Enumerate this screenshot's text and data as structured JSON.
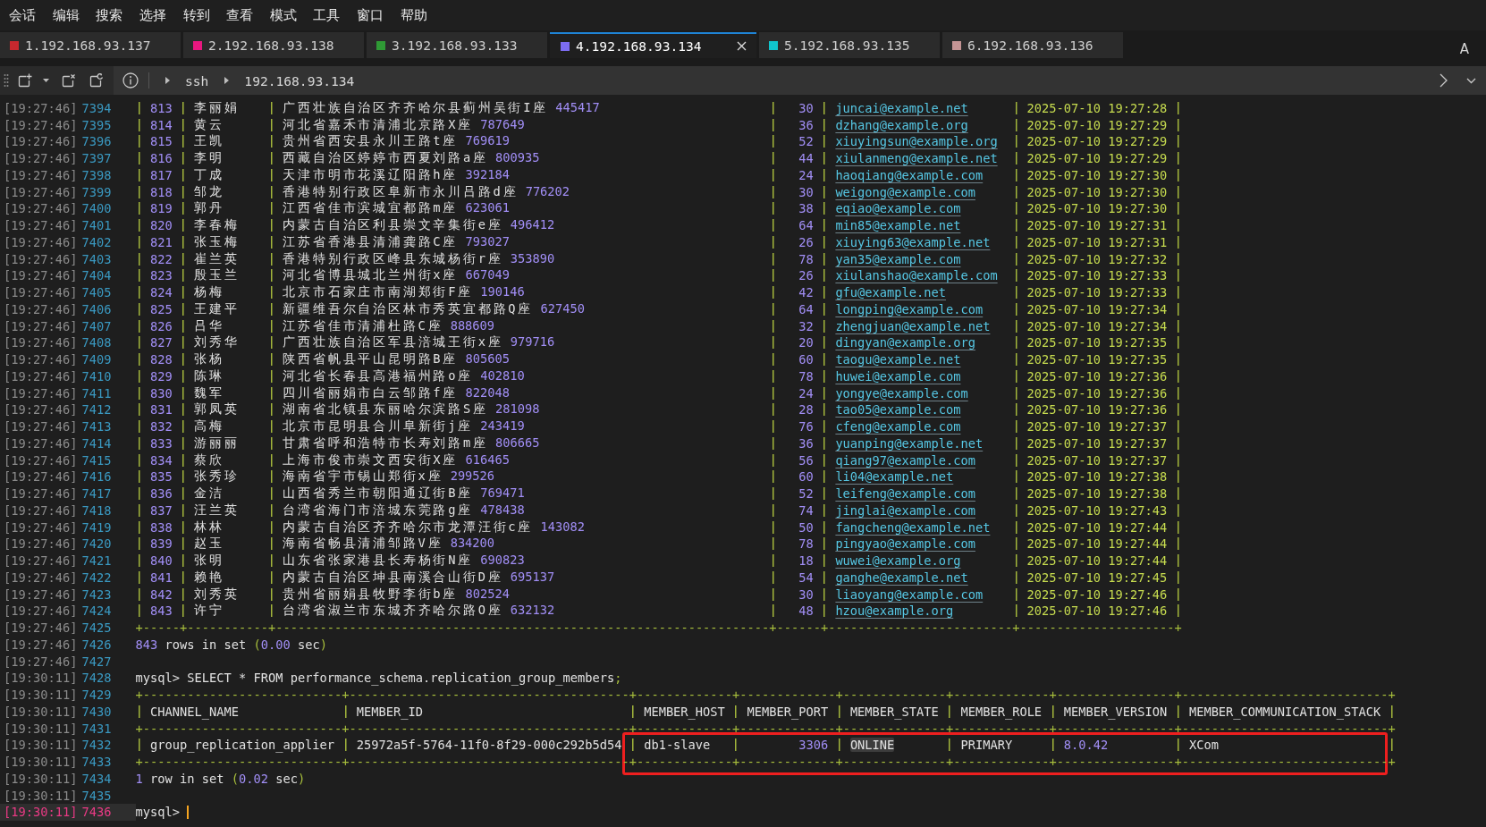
{
  "menu": [
    "会话",
    "编辑",
    "搜索",
    "选择",
    "转到",
    "查看",
    "模式",
    "工具",
    "窗口",
    "帮助"
  ],
  "tabs": [
    {
      "label": "1.192.168.93.137",
      "color": "#c8282e",
      "selected": false
    },
    {
      "label": "2.192.168.93.138",
      "color": "#e8177f",
      "selected": false
    },
    {
      "label": "3.192.168.93.133",
      "color": "#2f9a35",
      "selected": false
    },
    {
      "label": "4.192.168.93.134",
      "color": "#7c6cf0",
      "selected": true
    },
    {
      "label": "5.192.168.93.135",
      "color": "#10c4cc",
      "selected": false
    },
    {
      "label": "6.192.168.93.136",
      "color": "#c49494",
      "selected": false
    }
  ],
  "tab_bar_button": "A",
  "toolbar": {
    "breadcrumb": [
      "ssh",
      "192.168.93.134"
    ]
  },
  "terminal": {
    "lines": [
      {
        "time": "[19:27:46]",
        "number": "7394",
        "current": false,
        "kind": "record",
        "id": "813",
        "name": "李丽娟",
        "address": "广西壮族自治区齐齐哈尔县蓟州吴街I座",
        "postcode": "445417",
        "age": "30",
        "email": "juncai@example.net",
        "date": "2025-07-10 19:27:28"
      },
      {
        "time": "[19:27:46]",
        "number": "7395",
        "current": false,
        "kind": "record",
        "id": "814",
        "name": "黄云",
        "address": "河北省嘉禾市清浦北京路X座",
        "postcode": "787649",
        "age": "36",
        "email": "dzhang@example.org",
        "date": "2025-07-10 19:27:29"
      },
      {
        "time": "[19:27:46]",
        "number": "7396",
        "current": false,
        "kind": "record",
        "id": "815",
        "name": "王凯",
        "address": "贵州省西安县永川王路t座",
        "postcode": "769619",
        "age": "52",
        "email": "xiuyingsun@example.org",
        "date": "2025-07-10 19:27:29"
      },
      {
        "time": "[19:27:46]",
        "number": "7397",
        "current": false,
        "kind": "record",
        "id": "816",
        "name": "李明",
        "address": "西藏自治区婷婷市西夏刘路a座",
        "postcode": "800935",
        "age": "44",
        "email": "xiulanmeng@example.net",
        "date": "2025-07-10 19:27:29"
      },
      {
        "time": "[19:27:46]",
        "number": "7398",
        "current": false,
        "kind": "record",
        "id": "817",
        "name": "丁成",
        "address": "天津市明市花溪辽阳路h座",
        "postcode": "392184",
        "age": "24",
        "email": "haoqiang@example.com",
        "date": "2025-07-10 19:27:30"
      },
      {
        "time": "[19:27:46]",
        "number": "7399",
        "current": false,
        "kind": "record",
        "id": "818",
        "name": "邹龙",
        "address": "香港特别行政区阜新市永川吕路d座",
        "postcode": "776202",
        "age": "30",
        "email": "weigong@example.com",
        "date": "2025-07-10 19:27:30"
      },
      {
        "time": "[19:27:46]",
        "number": "7400",
        "current": false,
        "kind": "record",
        "id": "819",
        "name": "郭丹",
        "address": "江西省佳市滨城宜都路m座",
        "postcode": "623061",
        "age": "38",
        "email": "eqiao@example.com",
        "date": "2025-07-10 19:27:30"
      },
      {
        "time": "[19:27:46]",
        "number": "7401",
        "current": false,
        "kind": "record",
        "id": "820",
        "name": "李春梅",
        "address": "内蒙古自治区利县崇文辛集街e座",
        "postcode": "496412",
        "age": "64",
        "email": "min85@example.net",
        "date": "2025-07-10 19:27:31"
      },
      {
        "time": "[19:27:46]",
        "number": "7402",
        "current": false,
        "kind": "record",
        "id": "821",
        "name": "张玉梅",
        "address": "江苏省香港县清浦龚路C座",
        "postcode": "793027",
        "age": "26",
        "email": "xiuying63@example.net",
        "date": "2025-07-10 19:27:31"
      },
      {
        "time": "[19:27:46]",
        "number": "7403",
        "current": false,
        "kind": "record",
        "id": "822",
        "name": "崔兰英",
        "address": "香港特别行政区峰县东城杨街r座",
        "postcode": "353890",
        "age": "78",
        "email": "yan35@example.com",
        "date": "2025-07-10 19:27:32"
      },
      {
        "time": "[19:27:46]",
        "number": "7404",
        "current": false,
        "kind": "record",
        "id": "823",
        "name": "殷玉兰",
        "address": "河北省博县城北兰州街x座",
        "postcode": "667049",
        "age": "26",
        "email": "xiulanshao@example.com",
        "date": "2025-07-10 19:27:33"
      },
      {
        "time": "[19:27:46]",
        "number": "7405",
        "current": false,
        "kind": "record",
        "id": "824",
        "name": "杨梅",
        "address": "北京市石家庄市南湖郑街F座",
        "postcode": "190146",
        "age": "42",
        "email": "gfu@example.net",
        "date": "2025-07-10 19:27:33"
      },
      {
        "time": "[19:27:46]",
        "number": "7406",
        "current": false,
        "kind": "record",
        "id": "825",
        "name": "王建平",
        "address": "新疆维吾尔自治区林市秀英宜都路Q座",
        "postcode": "627450",
        "age": "64",
        "email": "longping@example.com",
        "date": "2025-07-10 19:27:34"
      },
      {
        "time": "[19:27:46]",
        "number": "7407",
        "current": false,
        "kind": "record",
        "id": "826",
        "name": "吕华",
        "address": "江苏省佳市清浦杜路C座",
        "postcode": "888609",
        "age": "32",
        "email": "zhengjuan@example.net",
        "date": "2025-07-10 19:27:34"
      },
      {
        "time": "[19:27:46]",
        "number": "7408",
        "current": false,
        "kind": "record",
        "id": "827",
        "name": "刘秀华",
        "address": "广西壮族自治区军县涪城王街x座",
        "postcode": "979716",
        "age": "20",
        "email": "dingyan@example.org",
        "date": "2025-07-10 19:27:35"
      },
      {
        "time": "[19:27:46]",
        "number": "7409",
        "current": false,
        "kind": "record",
        "id": "828",
        "name": "张杨",
        "address": "陕西省帆县平山昆明路B座",
        "postcode": "805605",
        "age": "60",
        "email": "taogu@example.net",
        "date": "2025-07-10 19:27:35"
      },
      {
        "time": "[19:27:46]",
        "number": "7410",
        "current": false,
        "kind": "record",
        "id": "829",
        "name": "陈琳",
        "address": "河北省长春县高港福州路o座",
        "postcode": "402810",
        "age": "78",
        "email": "huwei@example.com",
        "date": "2025-07-10 19:27:36"
      },
      {
        "time": "[19:27:46]",
        "number": "7411",
        "current": false,
        "kind": "record",
        "id": "830",
        "name": "魏军",
        "address": "四川省丽娟市白云邹路f座",
        "postcode": "822048",
        "age": "24",
        "email": "yongye@example.com",
        "date": "2025-07-10 19:27:36"
      },
      {
        "time": "[19:27:46]",
        "number": "7412",
        "current": false,
        "kind": "record",
        "id": "831",
        "name": "郭凤英",
        "address": "湖南省北镇县东丽哈尔滨路S座",
        "postcode": "281098",
        "age": "28",
        "email": "tao05@example.com",
        "date": "2025-07-10 19:27:36"
      },
      {
        "time": "[19:27:46]",
        "number": "7413",
        "current": false,
        "kind": "record",
        "id": "832",
        "name": "高梅",
        "address": "北京市昆明县合川阜新街j座",
        "postcode": "243419",
        "age": "76",
        "email": "cfeng@example.com",
        "date": "2025-07-10 19:27:37"
      },
      {
        "time": "[19:27:46]",
        "number": "7414",
        "current": false,
        "kind": "record",
        "id": "833",
        "name": "游丽丽",
        "address": "甘肃省呼和浩特市长寿刘路m座",
        "postcode": "806665",
        "age": "36",
        "email": "yuanping@example.net",
        "date": "2025-07-10 19:27:37"
      },
      {
        "time": "[19:27:46]",
        "number": "7415",
        "current": false,
        "kind": "record",
        "id": "834",
        "name": "蔡欣",
        "address": "上海市俊市崇文西安街X座",
        "postcode": "616465",
        "age": "56",
        "email": "qiang97@example.com",
        "date": "2025-07-10 19:27:37"
      },
      {
        "time": "[19:27:46]",
        "number": "7416",
        "current": false,
        "kind": "record",
        "id": "835",
        "name": "张秀珍",
        "address": "海南省宇市锡山郑街x座",
        "postcode": "299526",
        "age": "60",
        "email": "li04@example.net",
        "date": "2025-07-10 19:27:38"
      },
      {
        "time": "[19:27:46]",
        "number": "7417",
        "current": false,
        "kind": "record",
        "id": "836",
        "name": "金洁",
        "address": "山西省秀兰市朝阳通辽街B座",
        "postcode": "769471",
        "age": "52",
        "email": "leifeng@example.com",
        "date": "2025-07-10 19:27:38"
      },
      {
        "time": "[19:27:46]",
        "number": "7418",
        "current": false,
        "kind": "record",
        "id": "837",
        "name": "汪兰英",
        "address": "台湾省海门市涪城东莞路g座",
        "postcode": "478438",
        "age": "74",
        "email": "jinglai@example.com",
        "date": "2025-07-10 19:27:43"
      },
      {
        "time": "[19:27:46]",
        "number": "7419",
        "current": false,
        "kind": "record",
        "id": "838",
        "name": "林林",
        "address": "内蒙古自治区齐齐哈尔市龙潭汪街c座",
        "postcode": "143082",
        "age": "50",
        "email": "fangcheng@example.net",
        "date": "2025-07-10 19:27:44"
      },
      {
        "time": "[19:27:46]",
        "number": "7420",
        "current": false,
        "kind": "record",
        "id": "839",
        "name": "赵玉",
        "address": "海南省畅县清浦邹路V座",
        "postcode": "834200",
        "age": "78",
        "email": "pingyao@example.com",
        "date": "2025-07-10 19:27:44"
      },
      {
        "time": "[19:27:46]",
        "number": "7421",
        "current": false,
        "kind": "record",
        "id": "840",
        "name": "张明",
        "address": "山东省张家港县长寿杨街N座",
        "postcode": "690823",
        "age": "18",
        "email": "wuwei@example.org",
        "date": "2025-07-10 19:27:44"
      },
      {
        "time": "[19:27:46]",
        "number": "7422",
        "current": false,
        "kind": "record",
        "id": "841",
        "name": "赖艳",
        "address": "内蒙古自治区坤县南溪合山街D座",
        "postcode": "695137",
        "age": "54",
        "email": "ganghe@example.net",
        "date": "2025-07-10 19:27:45"
      },
      {
        "time": "[19:27:46]",
        "number": "7423",
        "current": false,
        "kind": "record",
        "id": "842",
        "name": "刘秀英",
        "address": "贵州省丽娟县牧野李街b座",
        "postcode": "802524",
        "age": "30",
        "email": "liaoyang@example.com",
        "date": "2025-07-10 19:27:46"
      },
      {
        "time": "[19:27:46]",
        "number": "7424",
        "current": false,
        "kind": "record",
        "id": "843",
        "name": "许宁",
        "address": "台湾省淑兰市东城齐齐哈尔路O座",
        "postcode": "632132",
        "age": "48",
        "email": "hzou@example.org",
        "date": "2025-07-10 19:27:46"
      },
      {
        "time": "[19:27:46]",
        "number": "7425",
        "current": false,
        "kind": "border",
        "text": "+-----+-----------+-------------------------------------------------------------------+------+-------------------------+---------------------+"
      },
      {
        "time": "[19:27:46]",
        "number": "7426",
        "current": false,
        "kind": "output",
        "segments": [
          {
            "text": "843",
            "kind": "number"
          },
          {
            "text": " rows in set ",
            "kind": "plain"
          },
          {
            "text": "(",
            "kind": "punct"
          },
          {
            "text": "0.00",
            "kind": "number"
          },
          {
            "text": " sec",
            "kind": "plain"
          },
          {
            "text": ")",
            "kind": "punct"
          }
        ]
      },
      {
        "time": "[19:27:46]",
        "number": "7427",
        "current": false,
        "kind": "blank"
      },
      {
        "time": "[19:30:11]",
        "number": "7428",
        "current": false,
        "kind": "prompt",
        "cursor": false,
        "segments": [
          {
            "text": "mysql> SELECT * FROM performance_schema.replication_group_members",
            "kind": "plain"
          },
          {
            "text": ";",
            "kind": "punct"
          }
        ]
      },
      {
        "time": "[19:30:11]",
        "number": "7429",
        "current": false,
        "kind": "border",
        "text": "+---------------------------+--------------------------------------+-------------+-------------+--------------+-------------+----------------+----------------------------+"
      },
      {
        "time": "[19:30:11]",
        "number": "7430",
        "current": false,
        "kind": "result_header",
        "boxed": false,
        "cells": [
          {
            "text": "CHANNEL_NAME",
            "kind": "text",
            "highlighted": false
          },
          {
            "text": "MEMBER_ID",
            "kind": "text",
            "highlighted": false
          },
          {
            "text": "MEMBER_HOST",
            "kind": "text",
            "highlighted": false
          },
          {
            "text": "MEMBER_PORT",
            "kind": "text",
            "highlighted": false
          },
          {
            "text": "MEMBER_STATE",
            "kind": "text",
            "highlighted": false
          },
          {
            "text": "MEMBER_ROLE",
            "kind": "text",
            "highlighted": false
          },
          {
            "text": "MEMBER_VERSION",
            "kind": "text",
            "highlighted": false
          },
          {
            "text": "MEMBER_COMMUNICATION_STACK",
            "kind": "text",
            "highlighted": false
          }
        ]
      },
      {
        "time": "[19:30:11]",
        "number": "7431",
        "current": false,
        "kind": "border",
        "text": "+---------------------------+--------------------------------------+-------------+-------------+--------------+-------------+----------------+----------------------------+"
      },
      {
        "time": "[19:30:11]",
        "number": "7432",
        "current": false,
        "kind": "result_row",
        "boxed": true,
        "cells": [
          {
            "text": "group_replication_applier",
            "kind": "text",
            "highlighted": false
          },
          {
            "text": "25972a5f-5764-11f0-8f29-000c292b5d54",
            "kind": "text",
            "highlighted": false
          },
          {
            "text": "db1-slave",
            "kind": "text",
            "highlighted": false
          },
          {
            "text": "3306",
            "kind": "integer",
            "highlighted": false
          },
          {
            "text": "ONLINE",
            "kind": "text",
            "highlighted": true
          },
          {
            "text": "PRIMARY",
            "kind": "text",
            "highlighted": false
          },
          {
            "text": "8.0.42",
            "kind": "version",
            "highlighted": false
          },
          {
            "text": "XCom",
            "kind": "text",
            "highlighted": false
          }
        ]
      },
      {
        "time": "[19:30:11]",
        "number": "7433",
        "current": false,
        "kind": "border",
        "text": "+---------------------------+--------------------------------------+-------------+-------------+--------------+-------------+----------------+----------------------------+"
      },
      {
        "time": "[19:30:11]",
        "number": "7434",
        "current": false,
        "kind": "output",
        "segments": [
          {
            "text": "1",
            "kind": "number"
          },
          {
            "text": " row in set ",
            "kind": "plain"
          },
          {
            "text": "(",
            "kind": "punct"
          },
          {
            "text": "0.02",
            "kind": "number"
          },
          {
            "text": " sec",
            "kind": "plain"
          },
          {
            "text": ")",
            "kind": "punct"
          }
        ]
      },
      {
        "time": "[19:30:11]",
        "number": "7435",
        "current": false,
        "kind": "blank"
      },
      {
        "time": "[19:30:11]",
        "number": "7436",
        "current": true,
        "kind": "prompt",
        "cursor": true,
        "segments": [
          {
            "text": "mysql>",
            "kind": "plain"
          }
        ]
      }
    ]
  }
}
